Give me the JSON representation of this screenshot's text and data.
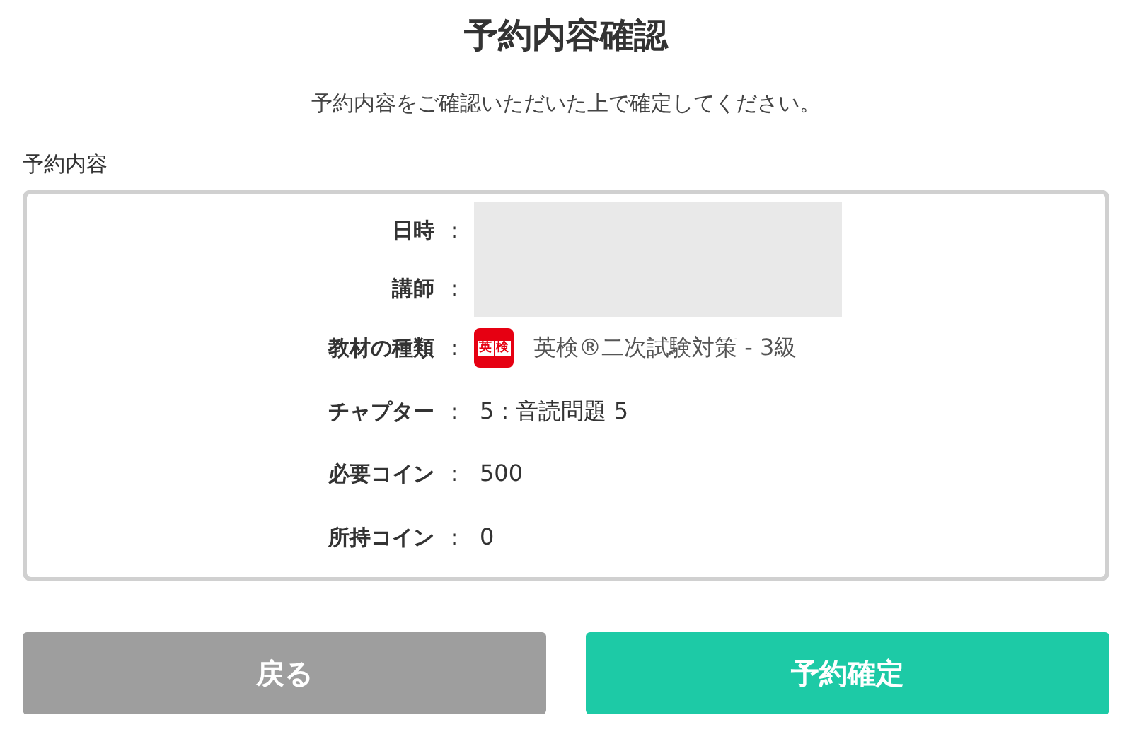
{
  "title": "予約内容確認",
  "subtitle": "予約内容をご確認いただいた上で確定してください。",
  "section_label": "予約内容",
  "rows": [
    {
      "label": "日時",
      "separator": ":",
      "kind": "redacted"
    },
    {
      "label": "講師",
      "separator": ":",
      "kind": "redacted"
    },
    {
      "label": "教材の種類",
      "separator": ":",
      "kind": "material",
      "badge": [
        "英",
        "検"
      ],
      "value": "英検®二次試験対策 - 3級"
    },
    {
      "label": "チャプター",
      "separator": ":",
      "kind": "text",
      "value": "5 : 音読問題 5"
    },
    {
      "label": "必要コイン",
      "separator": ":",
      "kind": "text",
      "value": "500"
    },
    {
      "label": "所持コイン",
      "separator": ":",
      "kind": "text",
      "value": "0"
    }
  ],
  "buttons": [
    {
      "label": "戻る",
      "kind": "secondary"
    },
    {
      "label": "予約確定",
      "kind": "primary"
    }
  ]
}
